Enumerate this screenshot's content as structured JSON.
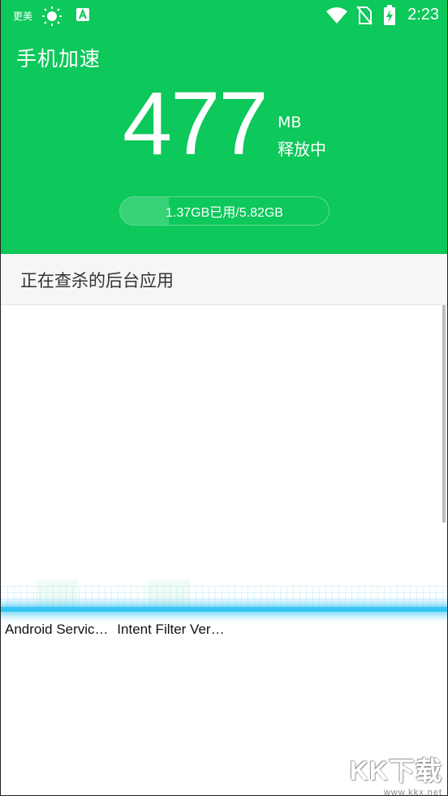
{
  "status_bar": {
    "left_label": "更美",
    "time": "2:23"
  },
  "header": {
    "title": "手机加速",
    "freed_value": "477",
    "freed_unit": "MB",
    "freed_label": "释放中",
    "memory_text": "1.37GB已用/5.82GB",
    "memory_used_fraction": 0.235
  },
  "section": {
    "label": "正在查杀的后台应用"
  },
  "apps": [
    {
      "name": "Android Servic…"
    },
    {
      "name": "Intent Filter Ver…"
    }
  ],
  "watermark": {
    "main": "KK下载",
    "sub": "www.kkx.net"
  },
  "colors": {
    "primary": "#0DC85A",
    "scan": "#35C6F4"
  }
}
